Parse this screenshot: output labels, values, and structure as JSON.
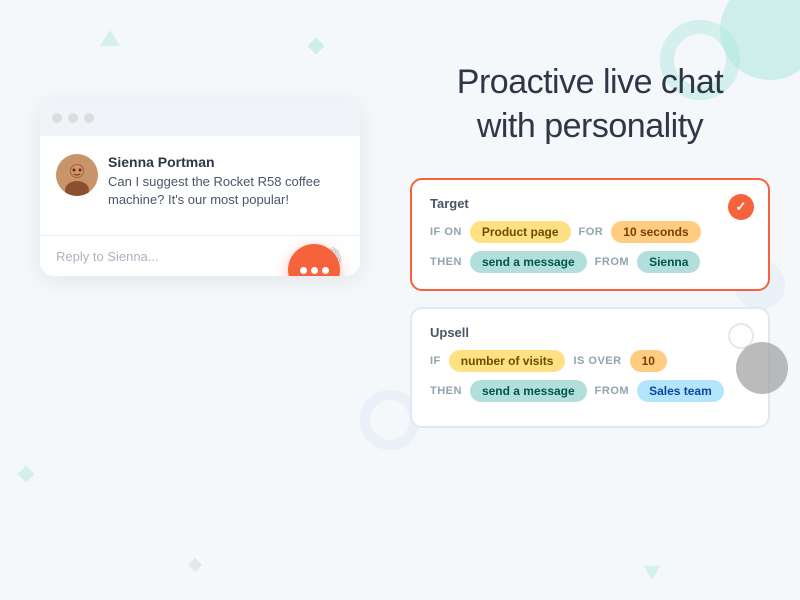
{
  "page": {
    "background": "#f5f8fa"
  },
  "headline": {
    "line1": "Proactive live chat",
    "line2": "with personality"
  },
  "chat": {
    "agent_name": "Sienna Portman",
    "message": "Can I suggest the Rocket R58 coffee machine? It's our most popular!",
    "reply_placeholder": "Reply to Sienna...",
    "trigger_button_label": "..."
  },
  "cards": [
    {
      "id": "target",
      "title": "Target",
      "active": true,
      "rows": [
        {
          "parts": [
            {
              "type": "label",
              "text": "IF ON"
            },
            {
              "type": "tag",
              "color": "yellow",
              "text": "Product page"
            },
            {
              "type": "label",
              "text": "FOR"
            },
            {
              "type": "tag",
              "color": "orange",
              "text": "10 seconds"
            }
          ]
        },
        {
          "parts": [
            {
              "type": "label",
              "text": "THEN"
            },
            {
              "type": "tag",
              "color": "teal",
              "text": "send a message"
            },
            {
              "type": "label",
              "text": "FROM"
            },
            {
              "type": "tag",
              "color": "teal",
              "text": "Sienna"
            }
          ]
        }
      ]
    },
    {
      "id": "upsell",
      "title": "Upsell",
      "active": false,
      "rows": [
        {
          "parts": [
            {
              "type": "label",
              "text": "IF"
            },
            {
              "type": "tag",
              "color": "yellow",
              "text": "number of visits"
            },
            {
              "type": "label",
              "text": "IS OVER"
            },
            {
              "type": "tag",
              "color": "orange",
              "text": "10"
            }
          ]
        },
        {
          "parts": [
            {
              "type": "label",
              "text": "THEN"
            },
            {
              "type": "tag",
              "color": "teal",
              "text": "send a message"
            },
            {
              "type": "label",
              "text": "FROM"
            },
            {
              "type": "tag",
              "color": "blue",
              "text": "Sales team"
            }
          ]
        }
      ]
    }
  ]
}
